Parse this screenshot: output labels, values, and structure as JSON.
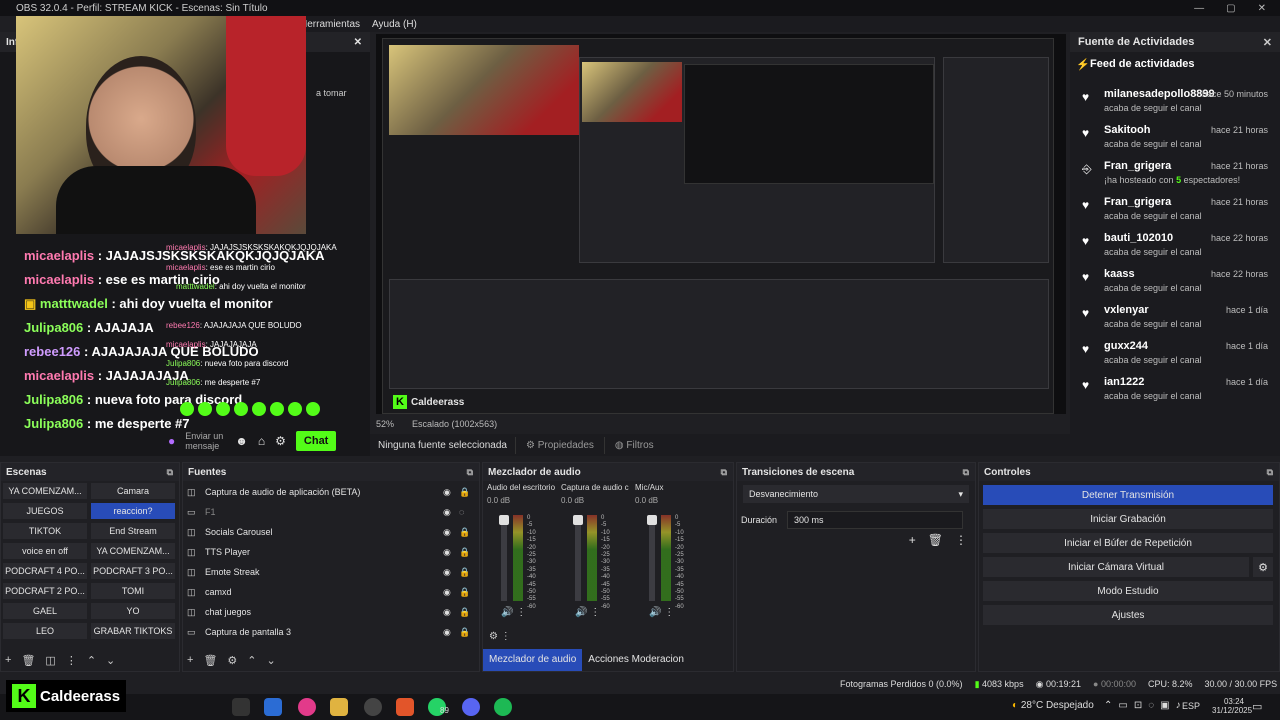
{
  "window": {
    "title": "OBS 32.0.4 - Perfil: STREAM KICK - Escenas: Sin Título",
    "menu": [
      "Herramientas",
      "Ayuda (H)"
    ]
  },
  "left_dock": {
    "title": "Inf",
    "partial_text": "a tomar"
  },
  "chat": {
    "lines": [
      {
        "user": "micaelaplis",
        "msg": ": JAJAJSJSKSKSKAKQKJQJQJAKA",
        "color": "pink"
      },
      {
        "user": "micaelaplis",
        "msg": ": ese es martin cirio",
        "color": "pink"
      },
      {
        "user": "matttwadel",
        "msg": ": ahi doy vuelta el monitor",
        "color": "green"
      },
      {
        "user": "Julipa806",
        "msg": ": AJAJAJA",
        "color": "green"
      },
      {
        "user": "rebee126",
        "msg": ": AJAJAJAJA QUE BOLUDO",
        "color": "violet"
      },
      {
        "user": "micaelaplis",
        "msg": ": JAJAJAJAJA",
        "color": "pink"
      },
      {
        "user": "Julipa806",
        "msg": ": nueva foto para discord",
        "color": "green"
      },
      {
        "user": "Julipa806",
        "msg": ": me desperte #7",
        "color": "green"
      }
    ],
    "overlay_lines": [
      {
        "user": "micaelaplis",
        "msg": ": JAJAJSJSKSKSKAKQKJQJQJAKA"
      },
      {
        "user": "micaelaplis",
        "msg": ": ese es martin cirio"
      },
      {
        "user": "matttwadel",
        "msg": ": ahi doy vuelta el monitor"
      },
      {
        "user": "rebee126",
        "msg": ": AJAJAJAJA QUE BOLUDO"
      },
      {
        "user": "micaelaplis",
        "msg": ": JAJAJAJAJA"
      },
      {
        "user": "Julipa806",
        "msg": ": nueva foto para discord"
      },
      {
        "user": "Julipa806",
        "msg": ": me desperte #7"
      }
    ],
    "input_placeholder": "Enviar un mensaje",
    "send_label": "Chat"
  },
  "preview": {
    "zoom": "52%",
    "scale_label": "Escalado (1002x563)"
  },
  "source_bar": {
    "label": "Ninguna fuente seleccionada",
    "properties": "Propiedades",
    "filters": "Filtros"
  },
  "feed": {
    "dock_title": "Fuente de Actividades",
    "title": "Feed de actividades",
    "items": [
      {
        "user": "milanesadepollo8899",
        "time": "hace 50 minutos",
        "desc": "acaba de seguir el canal",
        "icon": "heart"
      },
      {
        "user": "Sakitooh",
        "time": "hace 21 horas",
        "desc": "acaba de seguir el canal",
        "icon": "heart"
      },
      {
        "user": "Fran_grigera",
        "time": "hace 21 horas",
        "desc_pre": "¡ha hosteado con ",
        "desc_num": "5",
        "desc_post": " espectadores!",
        "icon": "host"
      },
      {
        "user": "Fran_grigera",
        "time": "hace 21 horas",
        "desc": "acaba de seguir el canal",
        "icon": "heart"
      },
      {
        "user": "bauti_102010",
        "time": "hace 22 horas",
        "desc": "acaba de seguir el canal",
        "icon": "heart"
      },
      {
        "user": "kaass",
        "time": "hace 22 horas",
        "desc": "acaba de seguir el canal",
        "icon": "heart"
      },
      {
        "user": "vxlenyar",
        "time": "hace 1 día",
        "desc": "acaba de seguir el canal",
        "icon": "heart"
      },
      {
        "user": "guxx244",
        "time": "hace 1 día",
        "desc": "acaba de seguir el canal",
        "icon": "heart"
      },
      {
        "user": "ian1222",
        "time": "hace 1 día",
        "desc": "acaba de seguir el canal",
        "icon": "heart"
      }
    ]
  },
  "scenes": {
    "title": "Escenas",
    "items": [
      "YA COMENZAM...",
      "Camara",
      "JUEGOS",
      "reaccion?",
      "TIKTOK",
      "End Stream",
      "voice en off",
      "YA COMENZAM...",
      "PODCRAFT 4 PO...",
      "PODCRAFT 3 PO...",
      "PODCRAFT 2 PO...",
      "TOMI",
      "GAEL",
      "YO",
      "LEO",
      "GRABAR TIKTOKS"
    ],
    "active_index": 3
  },
  "sources": {
    "title": "Fuentes",
    "items": [
      "Captura de audio de aplicación (BETA)",
      "F1",
      "Socials Carousel",
      "TTS Player",
      "Emote Streak",
      "camxd",
      "chat juegos",
      "Captura de pantalla 3"
    ]
  },
  "mixer": {
    "title": "Mezclador de audio",
    "channels": [
      {
        "name": "Audio del escritorio",
        "db": "0.0 dB"
      },
      {
        "name": "Captura de audio c",
        "db": "0.0 dB"
      },
      {
        "name": "Mic/Aux",
        "db": "0.0 dB"
      }
    ],
    "scale": [
      "0",
      "-5",
      "-10",
      "-15",
      "-20",
      "-25",
      "-30",
      "-35",
      "-40",
      "-45",
      "-50",
      "-55",
      "-60"
    ],
    "tabs": [
      "Mezclador de audio",
      "Acciones Moderacion"
    ]
  },
  "transitions": {
    "title": "Transiciones de escena",
    "selected": "Desvanecimiento",
    "duration_label": "Duración",
    "duration_value": "300 ms"
  },
  "controls": {
    "title": "Controles",
    "buttons": [
      "Detener Transmisión",
      "Iniciar Grabación",
      "Iniciar el Búfer de Repetición",
      "Iniciar Cámara Virtual",
      "Modo Estudio",
      "Ajustes"
    ]
  },
  "status": {
    "dropped": "Fotogramas Perdidos 0 (0.0%)",
    "bitrate": "4083 kbps",
    "stream_time": "00:19:21",
    "rec_time": "00:00:00",
    "cpu": "CPU: 8.2%",
    "fps": "30.00 / 30.00 FPS"
  },
  "kick": {
    "name": "Caldeerass"
  },
  "taskbar": {
    "weather": "28°C  Despejado",
    "lang": "ESP",
    "time": "03:24",
    "date": "31/12/2025",
    "badge": "89"
  },
  "colors": {
    "accent": "#284cb8",
    "kick_green": "#53fc18",
    "pink_user": "#ff7ab0",
    "green_user": "#8cff5a"
  }
}
